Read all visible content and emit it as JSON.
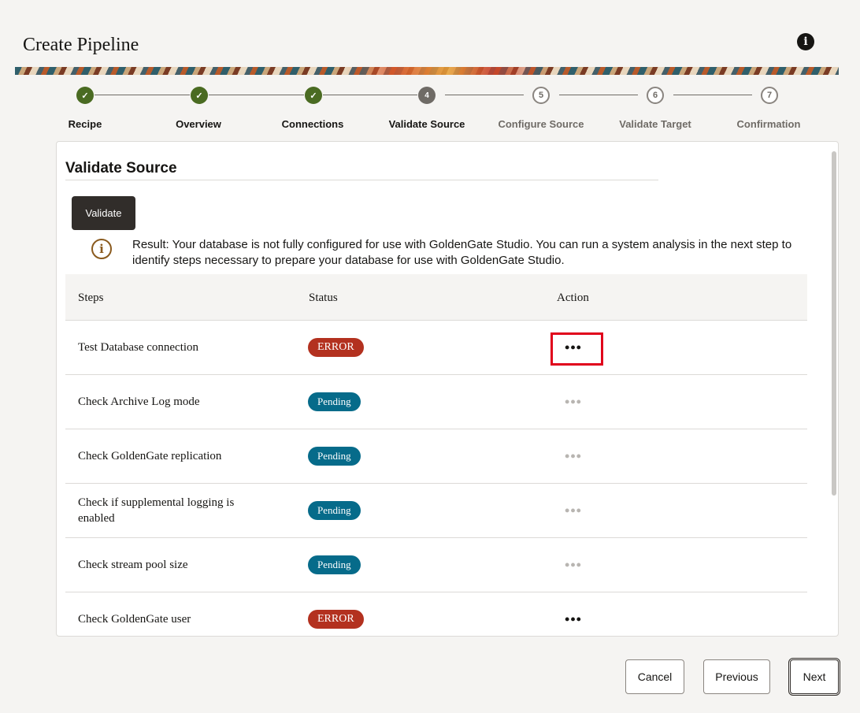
{
  "header": {
    "title": "Create Pipeline",
    "info_label": "i"
  },
  "stepper": {
    "steps": [
      {
        "label": "Recipe",
        "state": "done",
        "marker": "✓"
      },
      {
        "label": "Overview",
        "state": "done",
        "marker": "✓"
      },
      {
        "label": "Connections",
        "state": "done",
        "marker": "✓"
      },
      {
        "label": "Validate Source",
        "state": "current",
        "marker": "4"
      },
      {
        "label": "Configure Source",
        "state": "future",
        "marker": "5"
      },
      {
        "label": "Validate Target",
        "state": "future",
        "marker": "6"
      },
      {
        "label": "Confirmation",
        "state": "future",
        "marker": "7"
      }
    ]
  },
  "panel": {
    "title": "Validate Source",
    "validate_label": "Validate",
    "result_icon": "i",
    "result_text": "Result: Your database is not fully configured for use with GoldenGate Studio. You can run a system analysis in the next step to identify steps necessary to prepare your database for use with GoldenGate Studio."
  },
  "table": {
    "headers": {
      "steps": "Steps",
      "status": "Status",
      "action": "Action"
    },
    "rows": [
      {
        "step": "Test Database connection",
        "status": "ERROR",
        "action": "•••"
      },
      {
        "step": "Check Archive Log mode",
        "status": "Pending",
        "action": "•••"
      },
      {
        "step": "Check GoldenGate replication",
        "status": "Pending",
        "action": "•••"
      },
      {
        "step": "Check if supplemental logging is enabled",
        "status": "Pending",
        "action": "•••"
      },
      {
        "step": "Check stream pool size",
        "status": "Pending",
        "action": "•••"
      },
      {
        "step": "Check GoldenGate user",
        "status": "ERROR",
        "action": "•••"
      }
    ]
  },
  "footer": {
    "cancel": "Cancel",
    "previous": "Previous",
    "next": "Next"
  },
  "colors": {
    "done": "#4a6b22",
    "error": "#b3311f",
    "pending": "#066b8a",
    "highlight": "#e0001b"
  }
}
